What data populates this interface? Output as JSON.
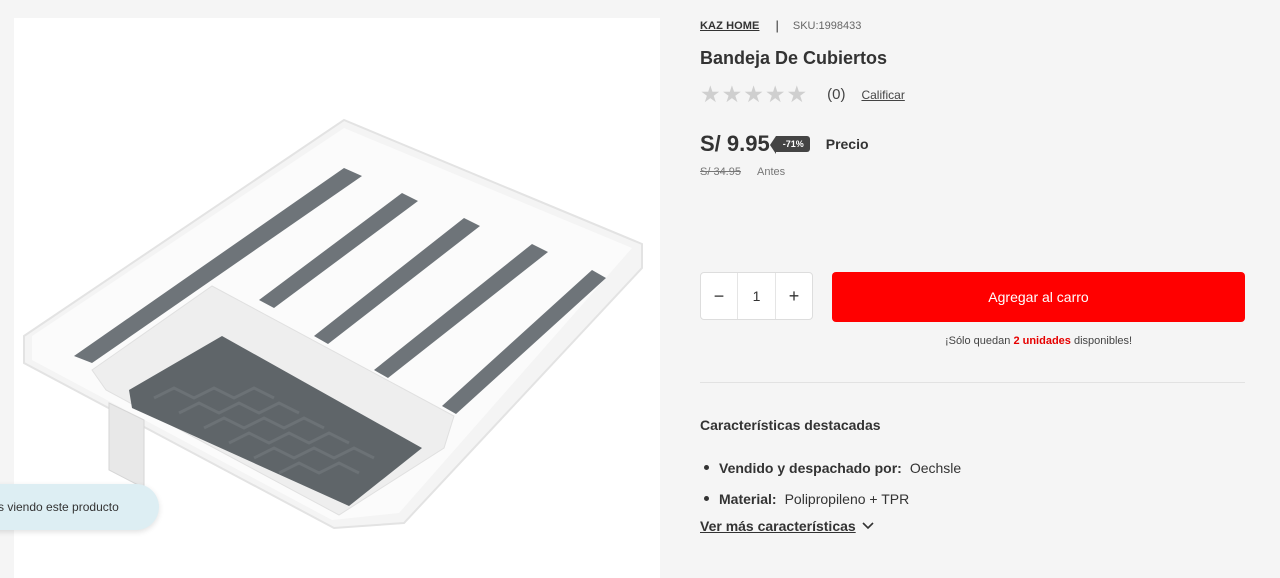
{
  "product": {
    "brand": "KAZ HOME",
    "separator": "|",
    "sku": "SKU:1998433",
    "title": "Bandeja De Cubiertos",
    "image_alt": "Bandeja de cubiertos blanca con fondo gris"
  },
  "rating": {
    "stars": [
      "★",
      "★",
      "★",
      "★",
      "★"
    ],
    "score": 0,
    "count": "(0)",
    "rate_link": "Calificar"
  },
  "price": {
    "current": "S/ 9.95",
    "discount_badge": "-71%",
    "label": "Precio",
    "old": "S/ 34.95",
    "old_label": "Antes"
  },
  "cart": {
    "minus": "−",
    "quantity": "1",
    "plus": "+",
    "add_button": "Agregar al carro",
    "stock_prefix": "¡Sólo quedan ",
    "stock_units": "2 unidades",
    "stock_suffix": " disponibles!"
  },
  "features": {
    "title": "Características destacadas",
    "items": [
      {
        "key": "Vendido y despachado por:",
        "value": "Oechsle"
      },
      {
        "key": "Material:",
        "value": "Polipropileno + TPR"
      }
    ],
    "more_link": "Ver más características"
  },
  "viewers_pill": "s viendo este producto",
  "colors": {
    "accent": "#ff0000",
    "units_highlight": "#e60000",
    "pill_bg": "#ddeef3"
  }
}
